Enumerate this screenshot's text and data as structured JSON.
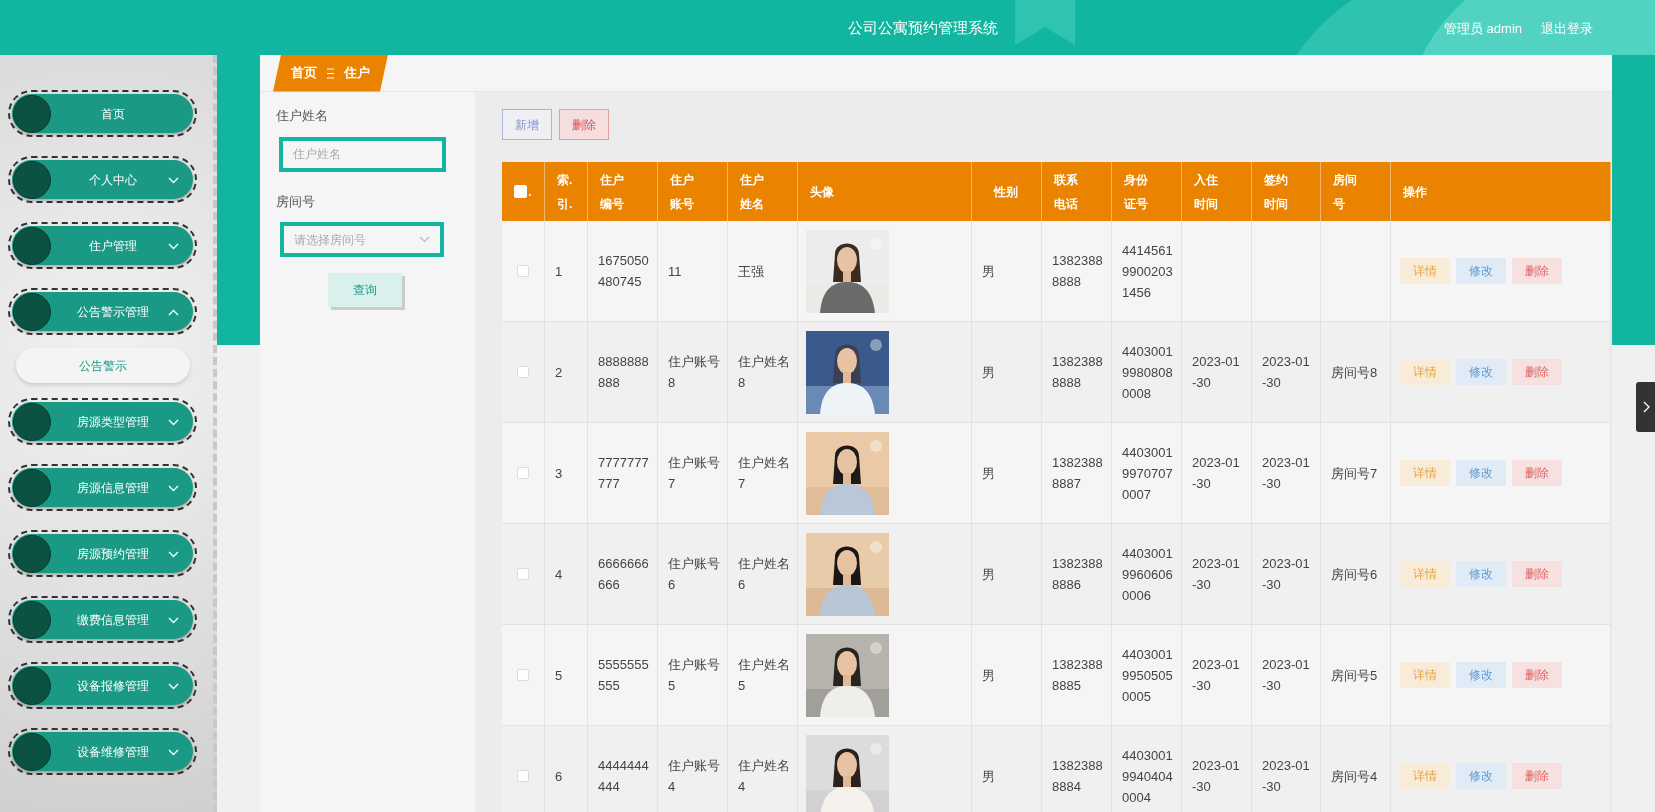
{
  "header": {
    "title": "公司公寓预约管理系统",
    "user": "管理员 admin",
    "logout": "退出登录"
  },
  "sidebar": {
    "items": [
      {
        "label": "首页",
        "kind": "link"
      },
      {
        "label": "个人中心",
        "kind": "menu",
        "expanded": false
      },
      {
        "label": "住户管理",
        "kind": "menu",
        "expanded": false
      },
      {
        "label": "公告警示管理",
        "kind": "menu",
        "expanded": true,
        "children": [
          {
            "label": "公告警示"
          }
        ]
      },
      {
        "label": "房源类型管理",
        "kind": "menu",
        "expanded": false
      },
      {
        "label": "房源信息管理",
        "kind": "menu",
        "expanded": false
      },
      {
        "label": "房源预约管理",
        "kind": "menu",
        "expanded": false
      },
      {
        "label": "缴费信息管理",
        "kind": "menu",
        "expanded": false
      },
      {
        "label": "设备报修管理",
        "kind": "menu",
        "expanded": false
      },
      {
        "label": "设备维修管理",
        "kind": "menu",
        "expanded": false
      }
    ]
  },
  "breadcrumb": [
    "首页",
    "住户"
  ],
  "search": {
    "fields": [
      {
        "label": "住户姓名",
        "placeholder": "住户姓名",
        "kind": "text"
      },
      {
        "label": "房间号",
        "placeholder": "请选择房间号",
        "kind": "select"
      }
    ],
    "button": "查询"
  },
  "actions": [
    {
      "label": "新增",
      "kind": "add"
    },
    {
      "label": "删除",
      "kind": "delete"
    }
  ],
  "table": {
    "select_all": {
      "checked": false,
      "mark": "."
    },
    "columns": [
      "索.引.",
      "住户编号",
      "住户账号",
      "住户姓名",
      "头像",
      "性别",
      "联系电话",
      "身份证号",
      "入住时间",
      "签约时间",
      "房间号",
      "操作"
    ],
    "rows": [
      {
        "checked": false,
        "index": "1",
        "number": "1675050480745",
        "account": "11",
        "name": "王强",
        "gender": "男",
        "phone": "13823888888",
        "id_number": "441456199002031456",
        "checkin": "",
        "signed": "",
        "room": "",
        "actions": [
          "详情",
          "修改",
          "删除"
        ]
      },
      {
        "checked": false,
        "index": "2",
        "number": "8888888888",
        "account": "住户账号8",
        "name": "住户姓名8",
        "gender": "男",
        "phone": "13823888888",
        "id_number": "440300199808080008",
        "checkin": "2023-01-30",
        "signed": "2023-01-30",
        "room": "房间号8",
        "actions": [
          "详情",
          "修改",
          "删除"
        ]
      },
      {
        "checked": false,
        "index": "3",
        "number": "7777777777",
        "account": "住户账号7",
        "name": "住户姓名7",
        "gender": "男",
        "phone": "13823888887",
        "id_number": "440300199707070007",
        "checkin": "2023-01-30",
        "signed": "2023-01-30",
        "room": "房间号7",
        "actions": [
          "详情",
          "修改",
          "删除"
        ]
      },
      {
        "checked": false,
        "index": "4",
        "number": "6666666666",
        "account": "住户账号6",
        "name": "住户姓名6",
        "gender": "男",
        "phone": "13823888886",
        "id_number": "440300199606060006",
        "checkin": "2023-01-30",
        "signed": "2023-01-30",
        "room": "房间号6",
        "actions": [
          "详情",
          "修改",
          "删除"
        ]
      },
      {
        "checked": false,
        "index": "5",
        "number": "5555555555",
        "account": "住户账号5",
        "name": "住户姓名5",
        "gender": "男",
        "phone": "13823888885",
        "id_number": "440300199505050005",
        "checkin": "2023-01-30",
        "signed": "2023-01-30",
        "room": "房间号5",
        "actions": [
          "详情",
          "修改",
          "删除"
        ]
      },
      {
        "checked": false,
        "index": "6",
        "number": "4444444444",
        "account": "住户账号4",
        "name": "住户姓名4",
        "gender": "男",
        "phone": "13823888884",
        "id_number": "440300199404040004",
        "checkin": "2023-01-30",
        "signed": "2023-01-30",
        "room": "房间号4",
        "actions": [
          "详情",
          "修改",
          "删除"
        ]
      }
    ]
  }
}
